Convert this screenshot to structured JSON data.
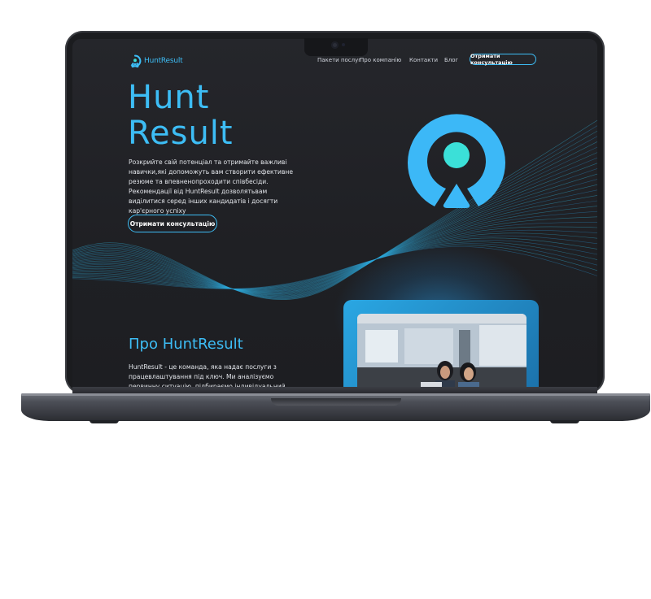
{
  "nav": {
    "logo_text": "HuntResult",
    "links": [
      "Пакети послуг",
      "Про компанію",
      "Контакти",
      "Блог"
    ],
    "cta": "Отримати консультацію"
  },
  "hero": {
    "title": "Hunt\nResult",
    "description": "Розкрийте свій потенціал та отримайте важливі навички,які допоможуть вам створити ефективне резюме та впевненопроходити співбесіди. Рекомендації від HuntResult дозволятьвам виділитися серед інших кандидатів і досягти кар'єрного успіху",
    "cta": "Отримати консультацію"
  },
  "about": {
    "title": "Про HuntResult",
    "description": "HuntResult - це команда, яка надає послуги з працевлаштування під ключ. Ми аналізуємо первинну ситуацію, підбираємо індивідуальний"
  },
  "colors": {
    "accent": "#3dbdf5",
    "accent_mint": "#3be0d8",
    "screen_bg": "#232428"
  }
}
